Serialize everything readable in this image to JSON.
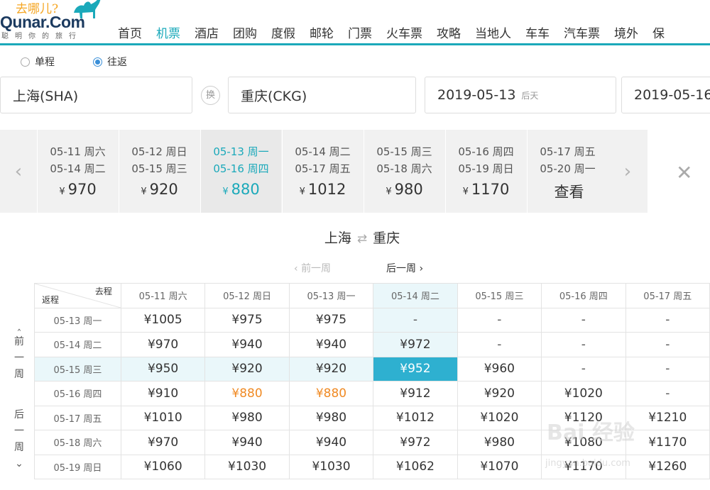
{
  "header": {
    "logo_cn": "去哪儿?",
    "logo_main": "Qunar.Com",
    "logo_sub": "聪明你的旅行",
    "nav": [
      "首页",
      "机票",
      "酒店",
      "团购",
      "度假",
      "邮轮",
      "门票",
      "火车票",
      "攻略",
      "当地人",
      "车车",
      "汽车票",
      "境外",
      "保"
    ],
    "active_nav": "机票"
  },
  "trip_type": {
    "one_way": "单程",
    "round_trip": "往返",
    "selected": "往返"
  },
  "search": {
    "from": "上海(SHA)",
    "swap_label": "换",
    "to": "重庆(CKG)",
    "depart_date": "2019-05-13",
    "depart_hint": "后天",
    "return_date": "2019-05-16"
  },
  "date_strip": [
    {
      "out": "05-11 周六",
      "ret": "05-14 周二",
      "currency": "¥",
      "price": "970"
    },
    {
      "out": "05-12 周日",
      "ret": "05-15 周三",
      "currency": "¥",
      "price": "920"
    },
    {
      "out": "05-13 周一",
      "ret": "05-16 周四",
      "currency": "¥",
      "price": "880",
      "selected": true
    },
    {
      "out": "05-14 周二",
      "ret": "05-17 周五",
      "currency": "¥",
      "price": "1012"
    },
    {
      "out": "05-15 周三",
      "ret": "05-18 周六",
      "currency": "¥",
      "price": "980"
    },
    {
      "out": "05-16 周四",
      "ret": "05-19 周日",
      "currency": "¥",
      "price": "1170"
    },
    {
      "out": "05-17 周五",
      "ret": "05-20 周一",
      "currency": "",
      "price": "查看"
    }
  ],
  "panel": {
    "route_from": "上海",
    "route_to": "重庆",
    "prev_week": "前一周",
    "next_week": "后一周",
    "side_prev": "前一周",
    "side_next": "后一周",
    "corner_go": "去程",
    "corner_return": "返程",
    "columns": [
      "05-11 周六",
      "05-12 周日",
      "05-13 周一",
      "05-14 周二",
      "05-15 周三",
      "05-16 周四",
      "05-17 周五"
    ],
    "rows": [
      {
        "label": "05-13 周一",
        "cells": [
          "¥1005",
          "¥975",
          "¥975",
          "-",
          "-",
          "-",
          "-"
        ]
      },
      {
        "label": "05-14 周二",
        "cells": [
          "¥970",
          "¥940",
          "¥940",
          "¥972",
          "-",
          "-",
          "-"
        ]
      },
      {
        "label": "05-15 周三",
        "cells": [
          "¥950",
          "¥920",
          "¥920",
          "¥952",
          "¥960",
          "-",
          "-"
        ]
      },
      {
        "label": "05-16 周四",
        "cells": [
          "¥910",
          "¥880",
          "¥880",
          "¥912",
          "¥920",
          "¥1020",
          "-"
        ]
      },
      {
        "label": "05-17 周五",
        "cells": [
          "¥1010",
          "¥980",
          "¥980",
          "¥1012",
          "¥1020",
          "¥1120",
          "¥1210"
        ]
      },
      {
        "label": "05-18 周六",
        "cells": [
          "¥970",
          "¥940",
          "¥940",
          "¥972",
          "¥980",
          "¥1080",
          "¥1170"
        ]
      },
      {
        "label": "05-19 周日",
        "cells": [
          "¥1060",
          "¥1030",
          "¥1030",
          "¥1062",
          "¥1070",
          "¥1170",
          "¥1260"
        ]
      }
    ],
    "highlight_row": 2,
    "highlight_col": 3,
    "low_price_cells": [
      [
        3,
        1
      ],
      [
        3,
        2
      ]
    ]
  },
  "watermark": {
    "main": "Bai 经验",
    "sub": "jingyan.baidu.com"
  },
  "colors": {
    "accent": "#1ba9ba",
    "selected_cell": "#2eb0d0",
    "low_price": "#f08a24",
    "highlight_bg": "#eaf7fa"
  }
}
